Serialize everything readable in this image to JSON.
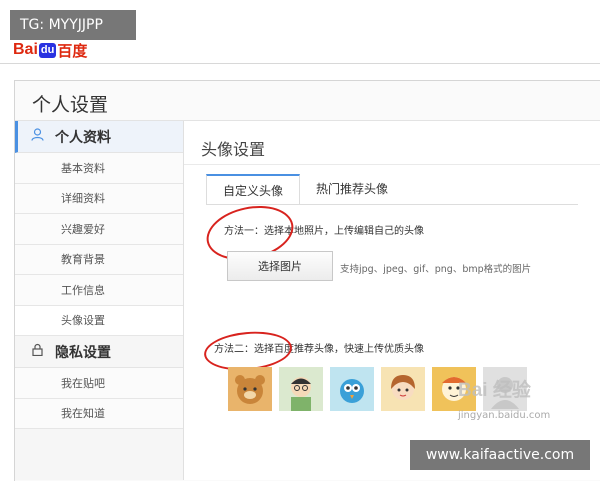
{
  "overlay": {
    "top_left_tag": "TG: MYYJJPP",
    "bottom_right_tag": "www.kaifaactive.com"
  },
  "header": {
    "logo_latin_1": "Bai",
    "logo_paw": "du",
    "logo_cn": "百度"
  },
  "page": {
    "title": "个人设置"
  },
  "sidebar": {
    "group_profile": "个人资料",
    "profile_items": [
      "基本资料",
      "详细资料",
      "兴趣爱好",
      "教育背景",
      "工作信息",
      "头像设置"
    ],
    "group_privacy": "隐私设置",
    "privacy_items": [
      "我在贴吧",
      "我在知道"
    ]
  },
  "main": {
    "section_title": "头像设置",
    "tabs": [
      "自定义头像",
      "热门推荐头像"
    ],
    "method1": "方法一：选择本地照片，上传编辑自己的头像",
    "choose_button": "选择图片",
    "support_text": "支持jpg、jpeg、gif、png、bmp格式的图片",
    "method2": "方法二：选择百度推荐头像，快速上传优质头像"
  },
  "watermark": {
    "main": "Bai 经验",
    "sub": "jingyan.baidu.com"
  },
  "colors": {
    "accent": "#4a90e2",
    "annotation_red": "#d8231e",
    "baidu_red": "#de2910",
    "baidu_blue": "#2932e1"
  }
}
